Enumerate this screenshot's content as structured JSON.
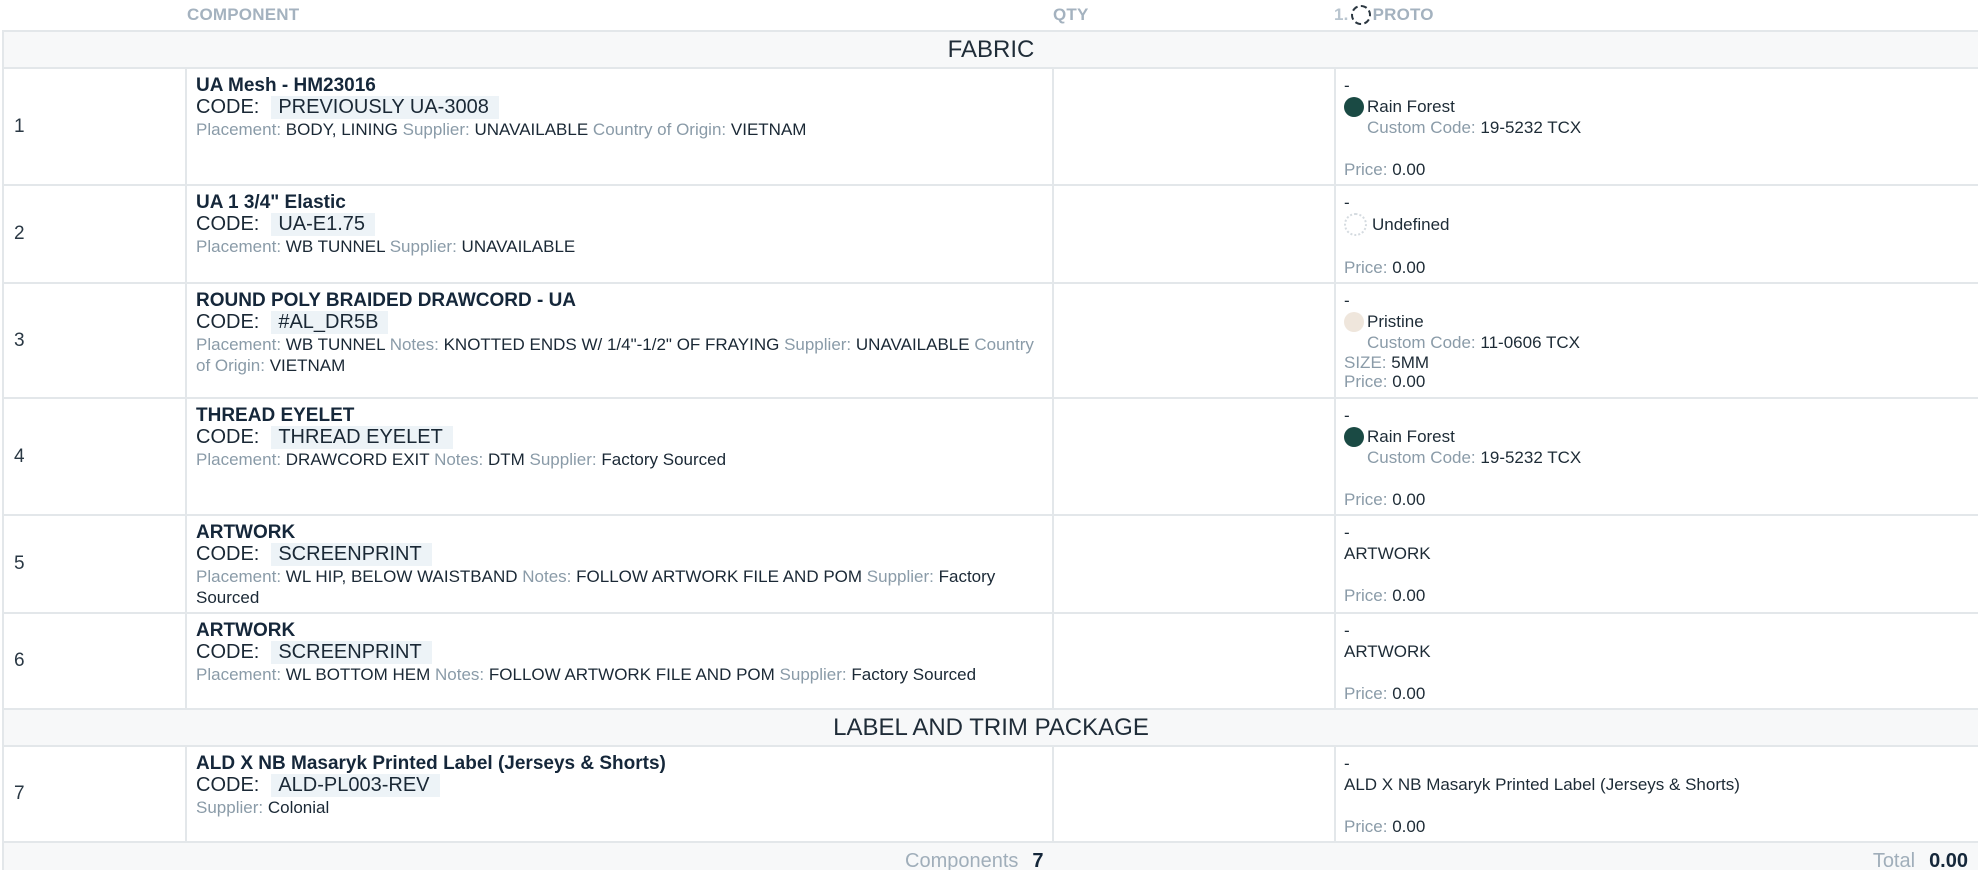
{
  "header": {
    "component": "COMPONENT",
    "qty": "QTY",
    "proto_num": "1.",
    "proto": "PROTO"
  },
  "sections": {
    "fabric": "FABRIC",
    "label_trim": "LABEL AND TRIM PACKAGE"
  },
  "labels": {
    "code": "CODE:",
    "placement": "Placement:",
    "supplier": "Supplier:",
    "country": "Country of Origin:",
    "notes": "Notes:",
    "custom_code": "Custom Code:",
    "price": "Price:",
    "size": "SIZE:"
  },
  "rows": [
    {
      "index": "1",
      "name": "UA Mesh - HM23016",
      "code": "PREVIOUSLY UA-3008",
      "placement": "BODY, LINING",
      "supplier": "UNAVAILABLE",
      "country": "VIETNAM",
      "dash": "-",
      "color_name": "Rain Forest",
      "color_hex": "#1a4a44",
      "custom_code": "19-5232 TCX",
      "price": "0.00"
    },
    {
      "index": "2",
      "name": "UA 1 3/4\" Elastic",
      "code": "UA-E1.75",
      "placement": "WB TUNNEL",
      "supplier": "UNAVAILABLE",
      "dash": "-",
      "color_name": "Undefined",
      "price": "0.00"
    },
    {
      "index": "3",
      "name": "ROUND POLY BRAIDED DRAWCORD - UA",
      "code": "#AL_DR5B",
      "placement": "WB TUNNEL",
      "notes": "KNOTTED ENDS W/ 1/4\"-1/2\" OF FRAYING",
      "supplier": "UNAVAILABLE",
      "country": "VIETNAM",
      "dash": "-",
      "color_name": "Pristine",
      "color_hex": "#efe6dc",
      "custom_code": "11-0606 TCX",
      "size": "5MM",
      "price": "0.00"
    },
    {
      "index": "4",
      "name": "THREAD EYELET",
      "code": "THREAD EYELET",
      "placement": "DRAWCORD EXIT",
      "notes": "DTM",
      "supplier": "Factory Sourced",
      "dash": "-",
      "color_name": "Rain Forest",
      "color_hex": "#1a4a44",
      "custom_code": "19-5232 TCX",
      "price": "0.00"
    },
    {
      "index": "5",
      "name": "ARTWORK",
      "code": "SCREENPRINT",
      "placement": "WL HIP, BELOW WAISTBAND",
      "notes": "FOLLOW ARTWORK FILE AND POM",
      "supplier": "Factory Sourced",
      "dash": "-",
      "desc": "ARTWORK",
      "price": "0.00"
    },
    {
      "index": "6",
      "name": "ARTWORK",
      "code": "SCREENPRINT",
      "placement": "WL BOTTOM HEM",
      "notes": "FOLLOW ARTWORK FILE AND POM",
      "supplier": "Factory Sourced",
      "dash": "-",
      "desc": "ARTWORK",
      "price": "0.00"
    },
    {
      "index": "7",
      "name": "ALD X NB Masaryk Printed Label (Jerseys & Shorts)",
      "code": "ALD-PL003-REV",
      "supplier": "Colonial",
      "dash": "-",
      "desc": "ALD X NB Masaryk Printed Label (Jerseys & Shorts)",
      "price": "0.00"
    }
  ],
  "footer": {
    "components_label": "Components",
    "components_count": "7",
    "total_label": "Total",
    "total_value": "0.00"
  }
}
